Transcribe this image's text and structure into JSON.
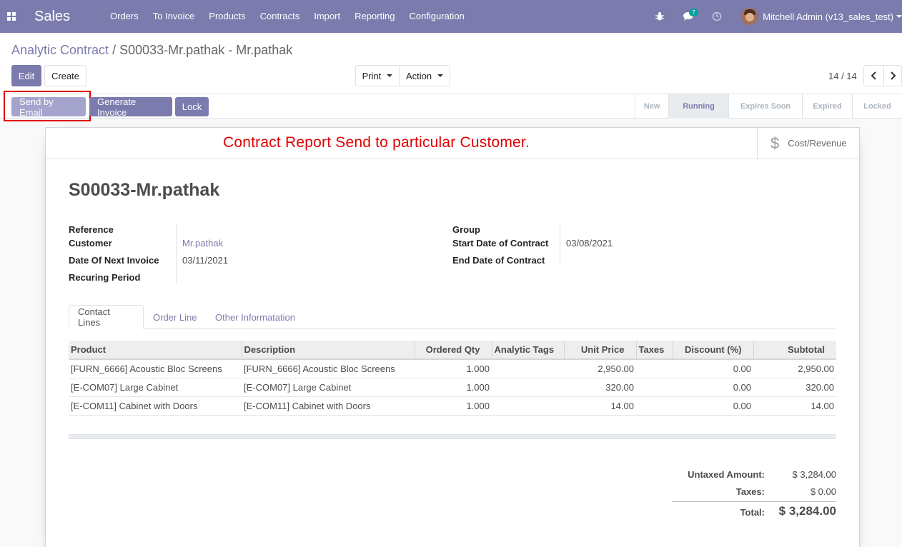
{
  "navbar": {
    "app_name": "Sales",
    "menu": [
      "Orders",
      "To Invoice",
      "Products",
      "Contracts",
      "Import",
      "Reporting",
      "Configuration"
    ],
    "messages_count": "7",
    "user": "Mitchell Admin (v13_sales_test)"
  },
  "breadcrumb": {
    "parent": "Analytic Contract",
    "separator": "/",
    "current": "S00033-Mr.pathak - Mr.pathak"
  },
  "toolbar": {
    "edit_label": "Edit",
    "create_label": "Create",
    "print_label": "Print",
    "action_label": "Action",
    "pager": "14 / 14"
  },
  "statusbar": {
    "send_email_label": "Send by Email",
    "generate_invoice_label": "Generate Invoice",
    "lock_label": "Lock",
    "stages": [
      "New",
      "Running",
      "Expires Soon",
      "Expired",
      "Locked"
    ],
    "active_stage": "Running"
  },
  "annotation": "Contract Report Send to particular Customer.",
  "smart_button": {
    "label": "Cost/Revenue",
    "icon": "dollar-icon"
  },
  "record": {
    "title": "S00033-Mr.pathak",
    "left_fields": [
      {
        "label": "Reference",
        "value": ""
      },
      {
        "label": "Customer",
        "value": "Mr.pathak"
      },
      {
        "label": "Date Of Next Invoice",
        "value": "03/11/2021"
      },
      {
        "label": "Recuring Period",
        "value": ""
      }
    ],
    "right_fields": [
      {
        "label": "Group",
        "value": ""
      },
      {
        "label": "Start Date of Contract",
        "value": "03/08/2021"
      },
      {
        "label": "End Date of Contract",
        "value": ""
      }
    ]
  },
  "tabs": [
    "Contact Lines",
    "Order Line",
    "Other Informatation"
  ],
  "lines": {
    "headers": [
      "Product",
      "Description",
      "Ordered Qty",
      "Analytic Tags",
      "Unit Price",
      "Taxes",
      "Discount (%)",
      "Subtotal"
    ],
    "rows": [
      [
        "[FURN_6666] Acoustic Bloc Screens",
        "[FURN_6666] Acoustic Bloc Screens",
        "1.000",
        "",
        "2,950.00",
        "",
        "0.00",
        "2,950.00"
      ],
      [
        "[E-COM07] Large Cabinet",
        "[E-COM07] Large Cabinet",
        "1.000",
        "",
        "320.00",
        "",
        "0.00",
        "320.00"
      ],
      [
        "[E-COM11] Cabinet with Doors",
        "[E-COM11] Cabinet with Doors",
        "1.000",
        "",
        "14.00",
        "",
        "0.00",
        "14.00"
      ]
    ]
  },
  "totals": {
    "untaxed_label": "Untaxed Amount:",
    "untaxed_value": "$ 3,284.00",
    "taxes_label": "Taxes:",
    "taxes_value": "$ 0.00",
    "total_label": "Total:",
    "total_value": "$ 3,284.00"
  },
  "colors": {
    "brand": "#7c7bad",
    "annotation_red": "#e00000",
    "badge": "#00a09d"
  }
}
